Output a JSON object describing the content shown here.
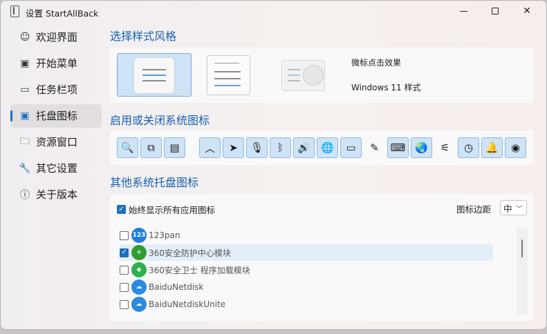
{
  "window": {
    "title": "设置 StartAllBack"
  },
  "sidebar": {
    "items": [
      {
        "label": "欢迎界面",
        "icon": "smile-icon"
      },
      {
        "label": "开始菜单",
        "icon": "start-menu-icon"
      },
      {
        "label": "任务栏项",
        "icon": "taskbar-icon"
      },
      {
        "label": "托盘图标",
        "icon": "tray-icon"
      },
      {
        "label": "资源窗口",
        "icon": "folder-icon"
      },
      {
        "label": "其它设置",
        "icon": "wrench-icon"
      },
      {
        "label": "关于版本",
        "icon": "info-icon"
      }
    ],
    "active_index": 3
  },
  "style_section": {
    "title": "选择样式风格",
    "options": [
      "微标点击效果",
      "Windows 11 样式"
    ]
  },
  "system_icons": {
    "title": "启用或关闭系统图标",
    "buttons": [
      {
        "icon": "search-icon",
        "glyph": "🔍",
        "on": true
      },
      {
        "icon": "task-view-icon",
        "glyph": "⧉",
        "on": true
      },
      {
        "icon": "widgets-icon",
        "glyph": "▤",
        "on": true
      },
      {
        "icon": "chevron-up-icon",
        "glyph": "︿",
        "on": true
      },
      {
        "icon": "location-icon",
        "glyph": "➤",
        "on": true
      },
      {
        "icon": "microphone-icon",
        "glyph": "🎙",
        "on": true
      },
      {
        "icon": "bluetooth-icon",
        "glyph": "ᛒ",
        "on": true
      },
      {
        "icon": "volume-icon",
        "glyph": "🔊",
        "on": true
      },
      {
        "icon": "network-icon",
        "glyph": "🌐",
        "on": true
      },
      {
        "icon": "battery-icon",
        "glyph": "▭",
        "on": true
      },
      {
        "icon": "pen-icon",
        "glyph": "✎",
        "on": false
      },
      {
        "icon": "keyboard-icon",
        "glyph": "⌨",
        "on": true
      },
      {
        "icon": "language-icon",
        "glyph": "🌏",
        "on": true
      },
      {
        "icon": "sliders-icon",
        "glyph": "⚟",
        "on": false
      },
      {
        "icon": "clock-icon",
        "glyph": "◷",
        "on": true
      },
      {
        "icon": "bell-icon",
        "glyph": "🔔",
        "on": true
      },
      {
        "icon": "eye-icon",
        "glyph": "◉",
        "on": true
      }
    ]
  },
  "tray_section": {
    "title": "其他系统托盘图标",
    "show_all_label": "始终显示所有应用图标",
    "show_all_checked": true,
    "margin_label": "图标边距",
    "margin_value": "中",
    "apps": [
      {
        "name": "123pan",
        "checked": false,
        "badge": "123",
        "color": "#1e7ee0"
      },
      {
        "name": "360安全防护中心模块",
        "checked": true,
        "badge": "+",
        "color": "#2f9e2f"
      },
      {
        "name": "360安全卫士 程序加载模块",
        "checked": false,
        "badge": "◆",
        "color": "#2bb24a"
      },
      {
        "name": "BaiduNetdisk",
        "checked": false,
        "badge": "☁",
        "color": "#2a8be0"
      },
      {
        "name": "BaiduNetdiskUnite",
        "checked": false,
        "badge": "☁",
        "color": "#2a8be0"
      }
    ]
  }
}
